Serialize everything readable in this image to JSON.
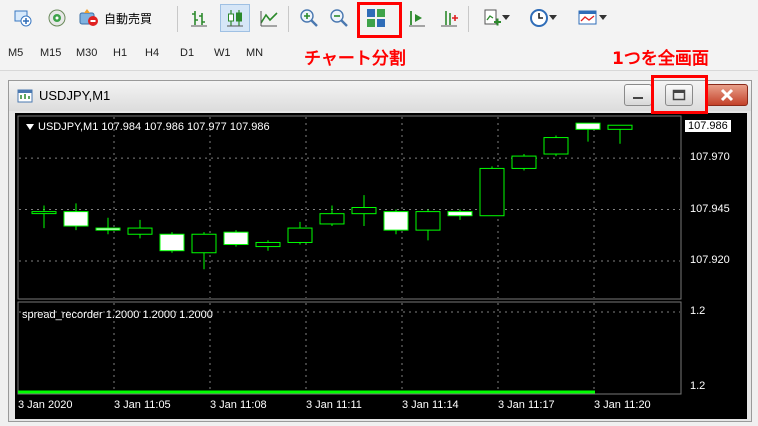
{
  "toolbar": {
    "autotrade_label": "自動売買",
    "icons": [
      "terminal-icon",
      "signals-icon",
      "auto-trading-icon",
      "bar-chart-icon",
      "candlestick-icon",
      "line-chart-icon",
      "zoom-in-icon",
      "zoom-out-icon",
      "tile-windows-icon",
      "chart-shift-icon",
      "autoscroll-icon",
      "indicators-icon",
      "periods-icon",
      "templates-icon"
    ]
  },
  "timeframes": [
    "M5",
    "M15",
    "M30",
    "H1",
    "H4",
    "D1",
    "W1",
    "MN"
  ],
  "annotations": {
    "split": "チャート分割",
    "fullscreen": "1つを全画面"
  },
  "colors": {
    "annotation": "#ff0000",
    "bull": "#00ff00",
    "chart_bg": "#000000"
  },
  "window": {
    "title": "USDJPY,M1"
  },
  "chart": {
    "header": "USDJPY,M1  107.984 107.986 107.977 107.986",
    "current_price": "107.986",
    "indicator_label": "spread_recorder 1.2000 1.2000 1.2000"
  },
  "chart_data": {
    "type": "candlestick",
    "price_ticks": [
      107.97,
      107.945,
      107.92
    ],
    "price_tick_labels": [
      "107.970",
      "107.945",
      "107.920"
    ],
    "y_range": [
      107.902,
      107.99
    ],
    "time_labels": [
      "3 Jan 2020",
      "3 Jan 11:05",
      "3 Jan 11:08",
      "3 Jan 11:11",
      "3 Jan 11:14",
      "3 Jan 11:17",
      "3 Jan 11:20"
    ],
    "candles": [
      {
        "o": 107.944,
        "c": 107.944,
        "h": 107.947,
        "l": 107.936
      },
      {
        "o": 107.944,
        "c": 107.937,
        "h": 107.948,
        "l": 107.935
      },
      {
        "o": 107.936,
        "c": 107.935,
        "h": 107.941,
        "l": 107.933
      },
      {
        "o": 107.933,
        "c": 107.936,
        "h": 107.94,
        "l": 107.931
      },
      {
        "o": 107.933,
        "c": 107.925,
        "h": 107.934,
        "l": 107.924
      },
      {
        "o": 107.924,
        "c": 107.933,
        "h": 107.934,
        "l": 107.916
      },
      {
        "o": 107.934,
        "c": 107.928,
        "h": 107.935,
        "l": 107.927
      },
      {
        "o": 107.927,
        "c": 107.929,
        "h": 107.93,
        "l": 107.925
      },
      {
        "o": 107.929,
        "c": 107.936,
        "h": 107.939,
        "l": 107.928
      },
      {
        "o": 107.938,
        "c": 107.943,
        "h": 107.947,
        "l": 107.937
      },
      {
        "o": 107.943,
        "c": 107.946,
        "h": 107.952,
        "l": 107.937
      },
      {
        "o": 107.944,
        "c": 107.935,
        "h": 107.945,
        "l": 107.933
      },
      {
        "o": 107.935,
        "c": 107.944,
        "h": 107.945,
        "l": 107.93
      },
      {
        "o": 107.944,
        "c": 107.942,
        "h": 107.945,
        "l": 107.94
      },
      {
        "o": 107.942,
        "c": 107.965,
        "h": 107.966,
        "l": 107.942
      },
      {
        "o": 107.965,
        "c": 107.971,
        "h": 107.972,
        "l": 107.964
      },
      {
        "o": 107.972,
        "c": 107.98,
        "h": 107.981,
        "l": 107.971
      },
      {
        "o": 107.987,
        "c": 107.984,
        "h": 107.987,
        "l": 107.978
      },
      {
        "o": 107.984,
        "c": 107.986,
        "h": 107.986,
        "l": 107.977
      }
    ],
    "indicator": {
      "name": "spread_recorder",
      "value": 1.2,
      "tick_labels": [
        "1.2",
        "1.2"
      ]
    },
    "grid": true
  }
}
